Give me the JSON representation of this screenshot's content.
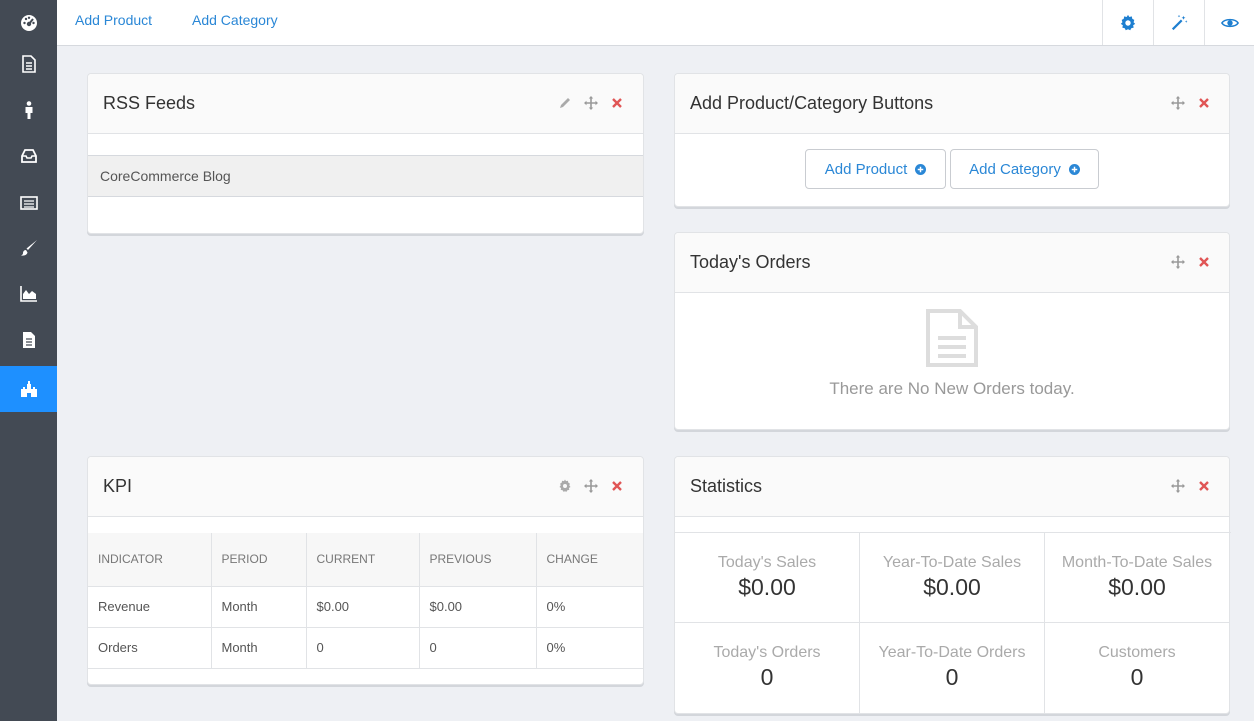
{
  "sidebar": {
    "items": [
      {
        "icon": "dashboard-icon"
      },
      {
        "icon": "document-icon"
      },
      {
        "icon": "person-icon"
      },
      {
        "icon": "inbox-icon"
      },
      {
        "icon": "list-icon"
      },
      {
        "icon": "brush-icon"
      },
      {
        "icon": "area-chart-icon"
      },
      {
        "icon": "file-text-icon"
      },
      {
        "icon": "castle-icon",
        "active": true
      }
    ],
    "active_color": "#1e90ff"
  },
  "topbar": {
    "links": [
      "Add Product",
      "Add Category"
    ],
    "icons": [
      "gear-icon",
      "magic-wand-icon",
      "eye-icon"
    ]
  },
  "rss": {
    "title": "RSS Feeds",
    "feed": "CoreCommerce Blog"
  },
  "add_buttons": {
    "title": "Add Product/Category Buttons",
    "product_label": "Add Product",
    "category_label": "Add Category"
  },
  "orders": {
    "title": "Today's Orders",
    "empty_message": "There are No New Orders today."
  },
  "kpi": {
    "title": "KPI",
    "headers": [
      "INDICATOR",
      "PERIOD",
      "CURRENT",
      "PREVIOUS",
      "CHANGE"
    ],
    "rows": [
      [
        "Revenue",
        "Month",
        "$0.00",
        "$0.00",
        "0%"
      ],
      [
        "Orders",
        "Month",
        "0",
        "0",
        "0%"
      ]
    ]
  },
  "statistics": {
    "title": "Statistics",
    "items": [
      {
        "label": "Today's Sales",
        "value": "$0.00"
      },
      {
        "label": "Year-To-Date Sales",
        "value": "$0.00"
      },
      {
        "label": "Month-To-Date Sales",
        "value": "$0.00"
      },
      {
        "label": "Today's Orders",
        "value": "0"
      },
      {
        "label": "Year-To-Date Orders",
        "value": "0"
      },
      {
        "label": "Customers",
        "value": "0"
      }
    ]
  },
  "colors": {
    "accent": "#2a87d6",
    "sidebar": "#434a54",
    "close": "#e05555"
  }
}
